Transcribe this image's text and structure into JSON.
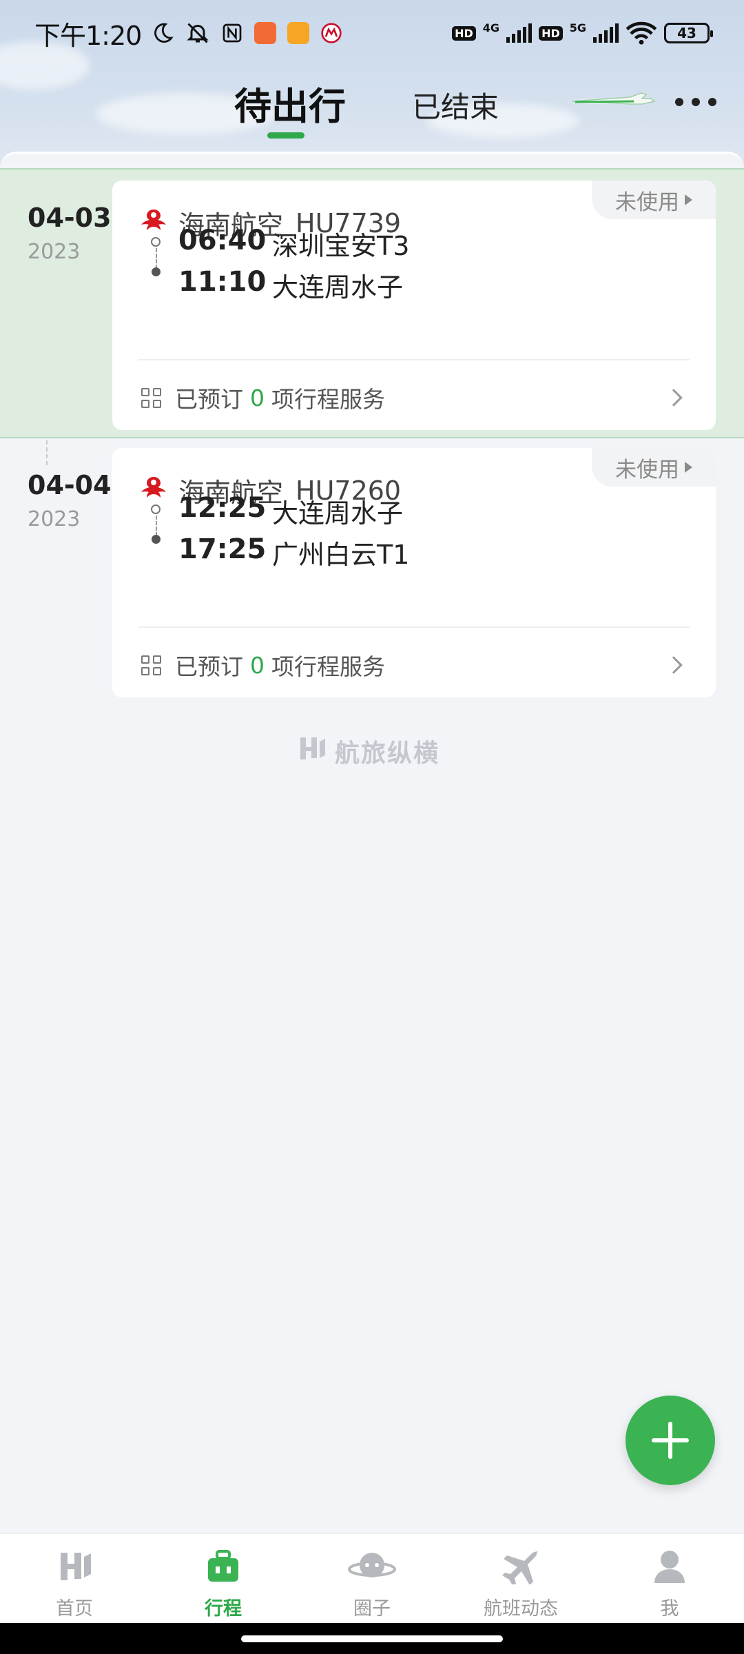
{
  "status_bar": {
    "time": "下午1:20",
    "net_4g": "4G",
    "net_5g": "5G",
    "hd": "HD",
    "battery": "43"
  },
  "tabs": [
    {
      "label": "待出行",
      "active": true
    },
    {
      "label": "已结束",
      "active": false
    }
  ],
  "accent_color": "#2ea84a",
  "trips": [
    {
      "date": "04-03",
      "year": "2023",
      "status": "未使用",
      "airline": "海南航空",
      "flight_no": "HU7739",
      "depart_time": "06:40",
      "depart_place": "深圳宝安T3",
      "arrive_time": "11:10",
      "arrive_place": "大连周水子",
      "service_prefix": "已预订",
      "service_count": "0",
      "service_suffix": "项行程服务"
    },
    {
      "date": "04-04",
      "year": "2023",
      "status": "未使用",
      "airline": "海南航空",
      "flight_no": "HU7260",
      "depart_time": "12:25",
      "depart_place": "大连周水子",
      "arrive_time": "17:25",
      "arrive_place": "广州白云T1",
      "service_prefix": "已预订",
      "service_count": "0",
      "service_suffix": "项行程服务"
    }
  ],
  "watermark": "航旅纵横",
  "bottom_nav": [
    {
      "label": "首页",
      "icon": "home-logo-icon"
    },
    {
      "label": "行程",
      "icon": "suitcase-icon",
      "active": true
    },
    {
      "label": "圈子",
      "icon": "planet-chat-icon"
    },
    {
      "label": "航班动态",
      "icon": "airplane-icon"
    },
    {
      "label": "我",
      "icon": "person-icon"
    }
  ]
}
